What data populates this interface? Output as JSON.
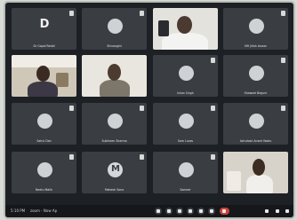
{
  "meeting": {
    "tiles": [
      {
        "name": "Dr Gopal Reddi",
        "letter": "D",
        "kind": "letter"
      },
      {
        "name": "Shivangini",
        "kind": "avatar"
      },
      {
        "name": "",
        "kind": "video"
      },
      {
        "name": "MH Jillah Anwar",
        "kind": "avatar"
      },
      {
        "name": "",
        "kind": "video"
      },
      {
        "name": "",
        "kind": "video"
      },
      {
        "name": "Ishan Singh",
        "kind": "avatar"
      },
      {
        "name": "Shaweel Begum",
        "kind": "avatar"
      },
      {
        "name": "Sahul Dan",
        "kind": "avatar"
      },
      {
        "name": "Sukhleen Sharma",
        "kind": "avatar"
      },
      {
        "name": "Sam Lucas",
        "kind": "avatar"
      },
      {
        "name": "Ashutosh Anant Yadav",
        "kind": "avatar"
      },
      {
        "name": "Neetu Malik",
        "kind": "avatar"
      },
      {
        "name": "Mahesh Sona",
        "letter": "M",
        "kind": "avatar"
      },
      {
        "name": "Sameer",
        "kind": "avatar"
      },
      {
        "name": "",
        "kind": "video"
      }
    ],
    "toolbar": {
      "time": "5:10 PM",
      "meeting_code": "zoom - Now Ap"
    }
  },
  "colors": {
    "background": "#1d2024",
    "tile": "#3a3d42",
    "leave": "#c9413a"
  }
}
